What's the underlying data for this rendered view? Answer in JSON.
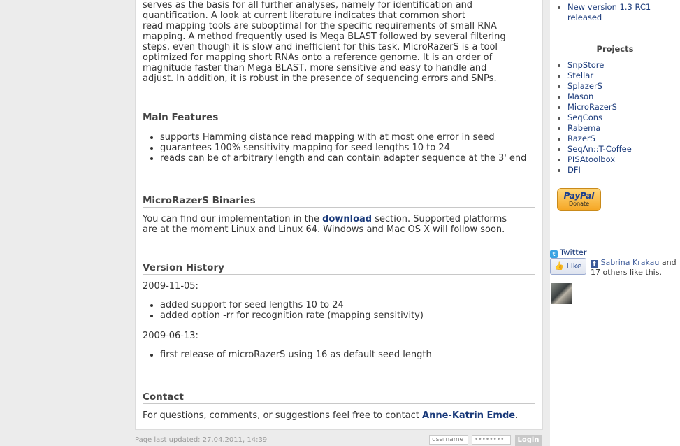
{
  "intro": {
    "lines": [
      "serves as the basis for all further analyses, namely for identification and",
      "quantification. A look at current literature indicates that common short",
      "read mapping tools are suboptimal for the specific requirements of small RNA",
      "mapping. A method frequently used is Mega BLAST followed by several filtering",
      "steps, even though it is slow and inefficient for this task. MicroRazerS is a tool",
      "optimized for mapping short RNAs onto a reference genome. It is an order of",
      "magnitude faster than Mega BLAST, more sensitive and easy to handle and",
      "adjust. In addition, it is robust in the presence of sequencing errors and SNPs."
    ]
  },
  "features": {
    "heading": "Main Features",
    "items": [
      "supports Hamming distance read mapping with at most one error in seed",
      "guarantees 100% sensitivity mapping for seed lengths 10 to 24",
      "reads can be of arbitrary length and can contain adapter sequence at the 3' end"
    ]
  },
  "binaries": {
    "heading": "MicroRazerS Binaries",
    "text_before": "You can find our implementation in the",
    "link": "download",
    "text_after": "section. Supported platforms",
    "line2": "are at the moment Linux and Linux 64. Windows and Mac OS X will follow soon."
  },
  "history": {
    "heading": "Version History",
    "date1": "2009-11-05:",
    "items1": [
      "added support for seed lengths 10 to 24",
      "added option -rr for recognition rate (mapping sensitivity)"
    ],
    "date2": "2009-06-13:",
    "items2": [
      "first release of microRazerS using 16 as default seed length"
    ]
  },
  "contact": {
    "heading": "Contact",
    "text": "For questions, comments, or suggestions feel free to contact",
    "link": "Anne-Katrin Emde",
    "end": "."
  },
  "sidebar": {
    "news_line1": "New version 1.3 RC1",
    "news_line2": "released",
    "projects_title": "Projects",
    "projects": [
      "SnpStore",
      "Stellar",
      "SplazerS",
      "Mason",
      "MicroRazerS",
      "SeqCons",
      "Rabema",
      "RazerS",
      "SeqAn::T-Coffee",
      "PISAtoolbox",
      "DFI"
    ],
    "paypal_label": "PayPal",
    "donate_label": "Donate",
    "twitter_label": "Twitter",
    "like_label": "Like",
    "like_name": "Sabrina Krakau",
    "like_rest1": "and",
    "like_rest2": "17 others like this."
  },
  "footer": {
    "updated": "Page last updated: 27.04.2011, 14:39",
    "username_placeholder": "username",
    "password_value": "••••••••",
    "login_label": "Login"
  }
}
